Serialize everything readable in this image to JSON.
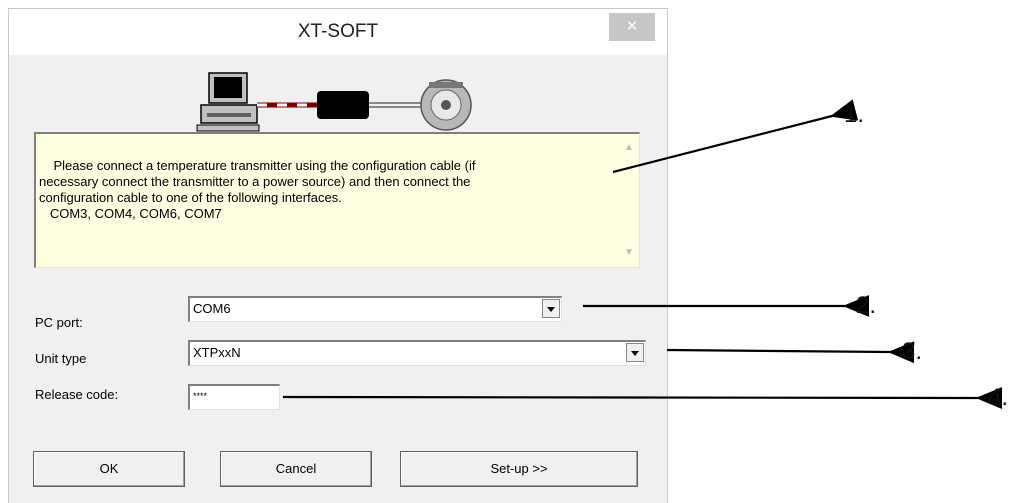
{
  "window": {
    "title": "XT-SOFT",
    "close_label": "×"
  },
  "info_text": "Please connect a temperature transmitter using the configuration cable (if\nnecessary connect the transmitter to a power source) and then connect the\nconfiguration cable to one of the following interfaces.\n   COM3, COM4, COM6, COM7",
  "form": {
    "pc_port_label": "PC port:",
    "pc_port_value": "COM6",
    "unit_type_label": "Unit type",
    "unit_type_value": "XTPxxN",
    "release_code_label": "Release code:",
    "release_code_value": "****"
  },
  "buttons": {
    "ok": "OK",
    "cancel": "Cancel",
    "setup": "Set-up >>"
  },
  "callouts": [
    "1.",
    "2.",
    "3.",
    "4."
  ]
}
